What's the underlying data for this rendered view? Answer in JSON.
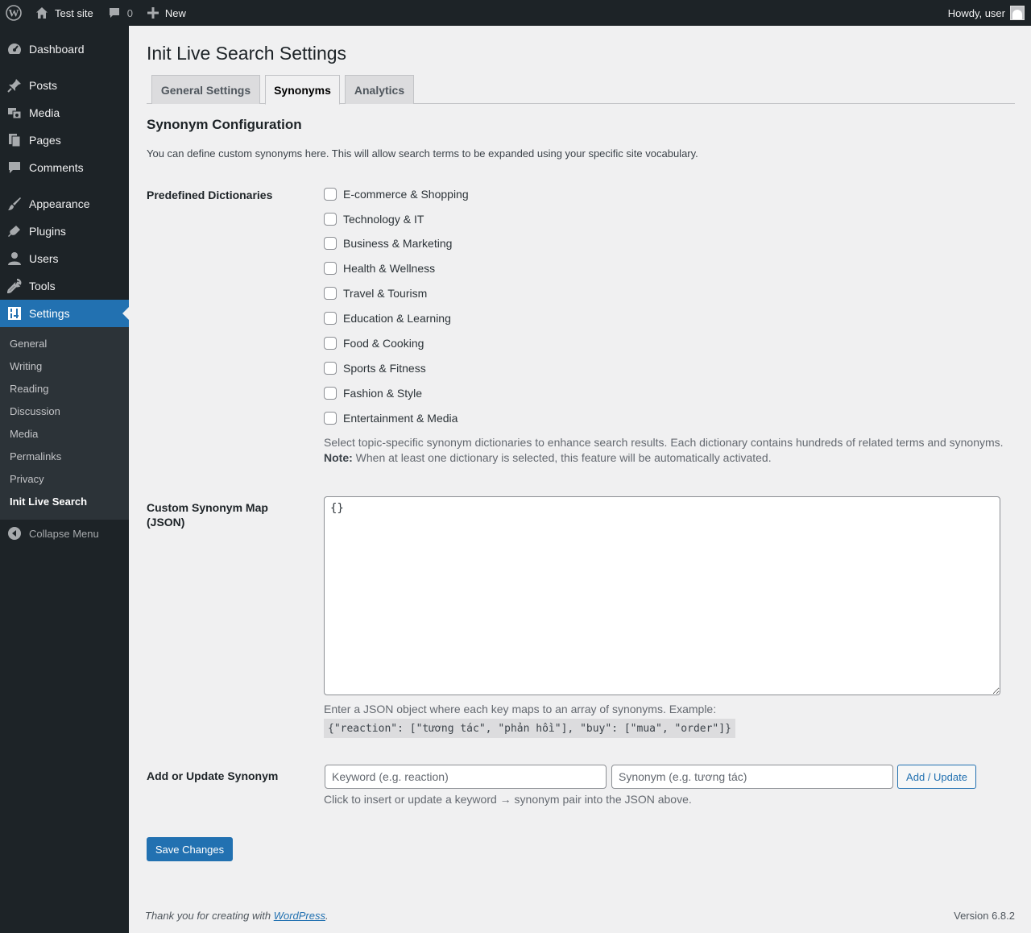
{
  "adminbar": {
    "site_name": "Test site",
    "comments_count": "0",
    "new_label": "New",
    "greeting": "Howdy, user"
  },
  "sidebar": {
    "items": [
      {
        "label": "Dashboard",
        "icon": "dashboard-icon"
      },
      {
        "label": "Posts",
        "icon": "pin-icon"
      },
      {
        "label": "Media",
        "icon": "media-icon"
      },
      {
        "label": "Pages",
        "icon": "pages-icon"
      },
      {
        "label": "Comments",
        "icon": "comment-icon"
      },
      {
        "label": "Appearance",
        "icon": "brush-icon"
      },
      {
        "label": "Plugins",
        "icon": "plug-icon"
      },
      {
        "label": "Users",
        "icon": "user-icon"
      },
      {
        "label": "Tools",
        "icon": "wrench-icon"
      },
      {
        "label": "Settings",
        "icon": "settings-icon"
      }
    ],
    "submenu": [
      "General",
      "Writing",
      "Reading",
      "Discussion",
      "Media",
      "Permalinks",
      "Privacy",
      "Init Live Search"
    ],
    "collapse_label": "Collapse Menu"
  },
  "page": {
    "title": "Init Live Search Settings",
    "tabs": [
      "General Settings",
      "Synonyms",
      "Analytics"
    ],
    "active_tab": "Synonyms",
    "section_title": "Synonym Configuration",
    "intro": "You can define custom synonyms here. This will allow search terms to be expanded using your specific site vocabulary."
  },
  "dictionaries": {
    "label": "Predefined Dictionaries",
    "options": [
      {
        "label": "E-commerce & Shopping",
        "checked": false
      },
      {
        "label": "Technology & IT",
        "checked": false
      },
      {
        "label": "Business & Marketing",
        "checked": false
      },
      {
        "label": "Health & Wellness",
        "checked": false
      },
      {
        "label": "Travel & Tourism",
        "checked": false
      },
      {
        "label": "Education & Learning",
        "checked": false
      },
      {
        "label": "Food & Cooking",
        "checked": false
      },
      {
        "label": "Sports & Fitness",
        "checked": false
      },
      {
        "label": "Fashion & Style",
        "checked": false
      },
      {
        "label": "Entertainment & Media",
        "checked": false
      }
    ],
    "description": "Select topic-specific synonym dictionaries to enhance search results. Each dictionary contains hundreds of related terms and synonyms.",
    "note_label": "Note:",
    "note_text": " When at least one dictionary is selected, this feature will be automatically activated."
  },
  "custom_map": {
    "label": "Custom Synonym Map (JSON)",
    "value": "{}",
    "description": "Enter a JSON object where each key maps to an array of synonyms. Example:",
    "example": "{\"reaction\": [\"tương tác\", \"phản hồi\"], \"buy\": [\"mua\", \"order\"]}"
  },
  "add_synonym": {
    "label": "Add or Update Synonym",
    "keyword_placeholder": "Keyword (e.g. reaction)",
    "synonym_placeholder": "Synonym (e.g. tương tác)",
    "button_label": "Add / Update",
    "description": "Click to insert or update a keyword → synonym pair into the JSON above."
  },
  "save_label": "Save Changes",
  "footer": {
    "thanks_prefix": "Thank you for creating with ",
    "thanks_link": "WordPress",
    "thanks_suffix": ".",
    "version": "Version 6.8.2"
  },
  "colors": {
    "admin_dark": "#1d2327",
    "accent": "#2271b1",
    "background": "#f0f0f1"
  }
}
